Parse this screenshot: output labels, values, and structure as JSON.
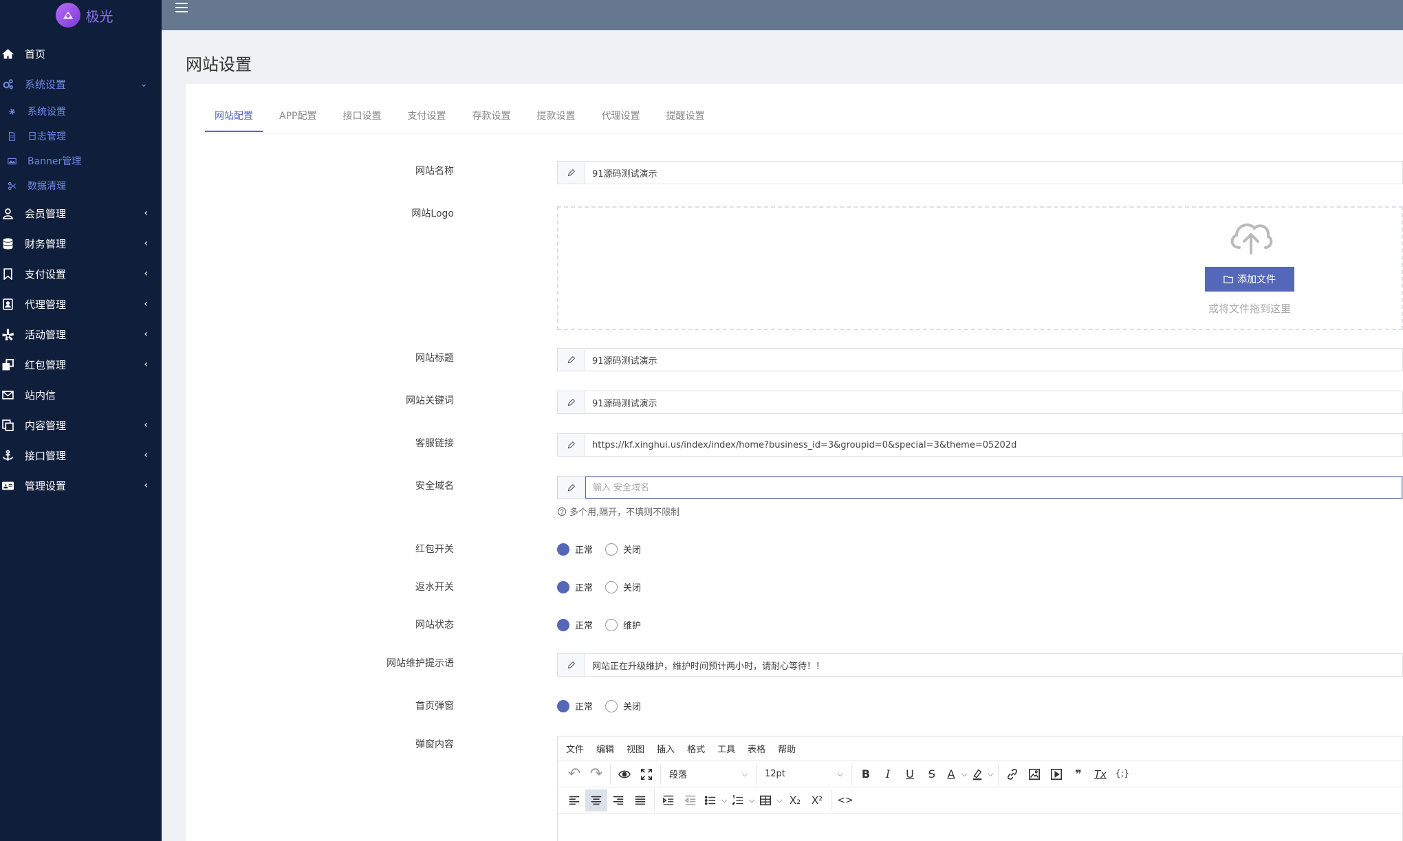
{
  "brand": {
    "name": "极光"
  },
  "sidebar": {
    "items": [
      {
        "label": "首页",
        "icon": "home-icon"
      },
      {
        "label": "系统设置",
        "icon": "cogs-icon",
        "active": true,
        "children": [
          {
            "label": "系统设置",
            "icon": "gear-icon"
          },
          {
            "label": "日志管理",
            "icon": "file-icon"
          },
          {
            "label": "Banner管理",
            "icon": "image-icon"
          },
          {
            "label": "数据清理",
            "icon": "scissors-icon"
          }
        ]
      },
      {
        "label": "会员管理",
        "icon": "user-icon"
      },
      {
        "label": "财务管理",
        "icon": "database-icon"
      },
      {
        "label": "支付设置",
        "icon": "bookmark-icon"
      },
      {
        "label": "代理管理",
        "icon": "contact-icon"
      },
      {
        "label": "活动管理",
        "icon": "yelp-icon"
      },
      {
        "label": "红包管理",
        "icon": "clone-icon"
      },
      {
        "label": "站内信",
        "icon": "envelope-icon"
      },
      {
        "label": "内容管理",
        "icon": "copy-icon"
      },
      {
        "label": "接口管理",
        "icon": "anchor-icon"
      },
      {
        "label": "管理设置",
        "icon": "id-card-icon"
      }
    ]
  },
  "page": {
    "title": "网站设置"
  },
  "tabs": [
    "网站配置",
    "APP配置",
    "接口设置",
    "支付设置",
    "存款设置",
    "提款设置",
    "代理设置",
    "提醒设置"
  ],
  "form": {
    "site_name": {
      "label": "网站名称",
      "value": "91源码测试演示"
    },
    "site_logo": {
      "label": "网站Logo",
      "button": "添加文件",
      "hint": "或将文件拖到这里"
    },
    "site_title": {
      "label": "网站标题",
      "value": "91源码测试演示"
    },
    "site_keywords": {
      "label": "网站关键词",
      "value": "91源码测试演示"
    },
    "service_link": {
      "label": "客服链接",
      "value": "https://kf.xinghui.us/index/index/home?business_id=3&groupid=0&special=3&theme=05202d"
    },
    "safe_domain": {
      "label": "安全域名",
      "placeholder": "输入 安全域名",
      "help": "多个用,隔开，不填则不限制"
    },
    "redpacket_switch": {
      "label": "红包开关",
      "on": "正常",
      "off": "关闭"
    },
    "rebate_switch": {
      "label": "返水开关",
      "on": "正常",
      "off": "关闭"
    },
    "site_status": {
      "label": "网站状态",
      "on": "正常",
      "off": "维护"
    },
    "maintain_tip": {
      "label": "网站维护提示语",
      "value": "网站正在升级维护，维护时间预计两小时，请耐心等待！！"
    },
    "home_popup": {
      "label": "首页弹窗",
      "on": "正常",
      "off": "关闭"
    },
    "popup_content": {
      "label": "弹窗内容"
    }
  },
  "editor": {
    "menus": [
      "文件",
      "编辑",
      "视图",
      "插入",
      "格式",
      "工具",
      "表格",
      "帮助"
    ],
    "block_format": "段落",
    "font_size": "12pt",
    "tool_glyphs": {
      "undo": "↶",
      "redo": "↷",
      "bold": "B",
      "italic": "I",
      "underline": "U",
      "strike": "S",
      "text_color": "A",
      "quote": "❞",
      "clear_format": "Tx",
      "code_sample": "{;}",
      "source_code": "<>",
      "subscript": "X₂",
      "superscript": "X²"
    }
  }
}
